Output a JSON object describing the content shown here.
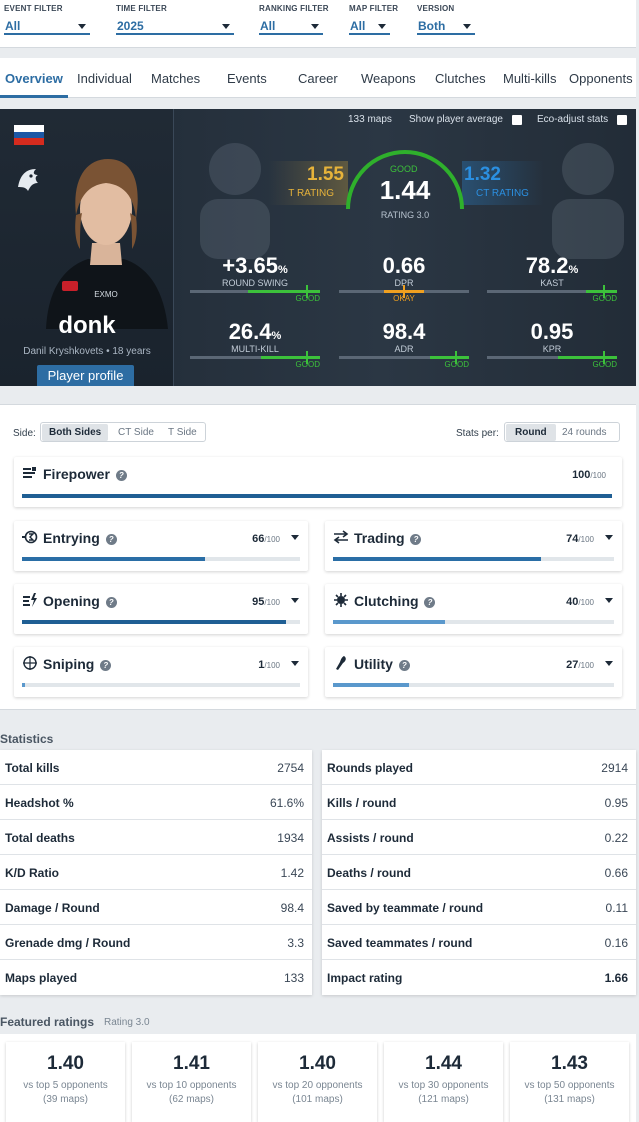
{
  "filters": [
    {
      "label": "EVENT FILTER",
      "value": "All"
    },
    {
      "label": "TIME FILTER",
      "value": "2025"
    },
    {
      "label": "RANKING FILTER",
      "value": "All"
    },
    {
      "label": "MAP FILTER",
      "value": "All"
    },
    {
      "label": "VERSION",
      "value": "Both"
    }
  ],
  "tabs": [
    "Overview",
    "Individual",
    "Matches",
    "Events",
    "Career",
    "Weapons",
    "Clutches",
    "Multi-kills",
    "Opponents"
  ],
  "hero": {
    "maps_count": "133 maps",
    "show_avg_label": "Show player average",
    "eco_label": "Eco-adjust stats",
    "player_name": "donk",
    "player_sub": "Danil Kryshkovets • 18 years",
    "profile_button": "Player profile",
    "t_rating": {
      "value": "1.55",
      "label": "T RATING"
    },
    "ct_rating": {
      "value": "1.32",
      "label": "CT RATING"
    },
    "rating": {
      "value": "1.44",
      "label": "RATING 3.0",
      "quality": "GOOD"
    },
    "stats": [
      {
        "value": "+3.65",
        "unit": "%",
        "label": "ROUND SWING",
        "quality": "GOOD"
      },
      {
        "value": "0.66",
        "unit": "",
        "label": "DPR",
        "quality": "OKAY"
      },
      {
        "value": "78.2",
        "unit": "%",
        "label": "KAST",
        "quality": "GOOD"
      },
      {
        "value": "26.4",
        "unit": "%",
        "label": "MULTI-KILL",
        "quality": "GOOD"
      },
      {
        "value": "98.4",
        "unit": "",
        "label": "ADR",
        "quality": "GOOD"
      },
      {
        "value": "0.95",
        "unit": "",
        "label": "KPR",
        "quality": "GOOD"
      }
    ],
    "flag_colors": [
      "#ffffff",
      "#1c57a5",
      "#d52b1e"
    ],
    "good_color": "#3cc13b",
    "okay_color": "#f0a020"
  },
  "roles_panel": {
    "side_label": "Side:",
    "side_options": [
      "Both Sides",
      "CT Side",
      "T Side"
    ],
    "per_label": "Stats per:",
    "per_options": [
      "Round",
      "24 rounds"
    ],
    "max_label": "/100",
    "roles": [
      {
        "name": "Firepower",
        "score": "100",
        "fill": 1.0
      },
      {
        "name": "Entrying",
        "score": "66",
        "fill": 0.66
      },
      {
        "name": "Trading",
        "score": "74",
        "fill": 0.74
      },
      {
        "name": "Opening",
        "score": "95",
        "fill": 0.95
      },
      {
        "name": "Clutching",
        "score": "40",
        "fill": 0.4
      },
      {
        "name": "Sniping",
        "score": "1",
        "fill": 0.01
      },
      {
        "name": "Utility",
        "score": "27",
        "fill": 0.27
      }
    ]
  },
  "statistics": {
    "title": "Statistics",
    "left": [
      {
        "k": "Total kills",
        "v": "2754"
      },
      {
        "k": "Headshot %",
        "v": "61.6%"
      },
      {
        "k": "Total deaths",
        "v": "1934"
      },
      {
        "k": "K/D Ratio",
        "v": "1.42"
      },
      {
        "k": "Damage / Round",
        "v": "98.4"
      },
      {
        "k": "Grenade dmg / Round",
        "v": "3.3"
      },
      {
        "k": "Maps played",
        "v": "133"
      }
    ],
    "right": [
      {
        "k": "Rounds played",
        "v": "2914"
      },
      {
        "k": "Kills / round",
        "v": "0.95"
      },
      {
        "k": "Assists / round",
        "v": "0.22"
      },
      {
        "k": "Deaths / round",
        "v": "0.66"
      },
      {
        "k": "Saved by teammate / round",
        "v": "0.11"
      },
      {
        "k": "Saved teammates / round",
        "v": "0.16"
      },
      {
        "k": "Impact rating",
        "v": "1.66"
      }
    ]
  },
  "featured": {
    "title": "Featured ratings",
    "subtitle": "Rating 3.0",
    "cards": [
      {
        "value": "1.40",
        "label": "vs top 5 opponents",
        "maps": "(39 maps)"
      },
      {
        "value": "1.41",
        "label": "vs top 10 opponents",
        "maps": "(62 maps)"
      },
      {
        "value": "1.40",
        "label": "vs top 20 opponents",
        "maps": "(101 maps)"
      },
      {
        "value": "1.44",
        "label": "vs top 30 opponents",
        "maps": "(121 maps)"
      },
      {
        "value": "1.43",
        "label": "vs top 50 opponents",
        "maps": "(131 maps)"
      }
    ]
  },
  "colors": {
    "accent": "#2d6da3",
    "t_color": "#e7b33a",
    "ct_color": "#2b8fe0",
    "bar_dark": "#1f5f94",
    "bar_light": "#5a98cc"
  }
}
